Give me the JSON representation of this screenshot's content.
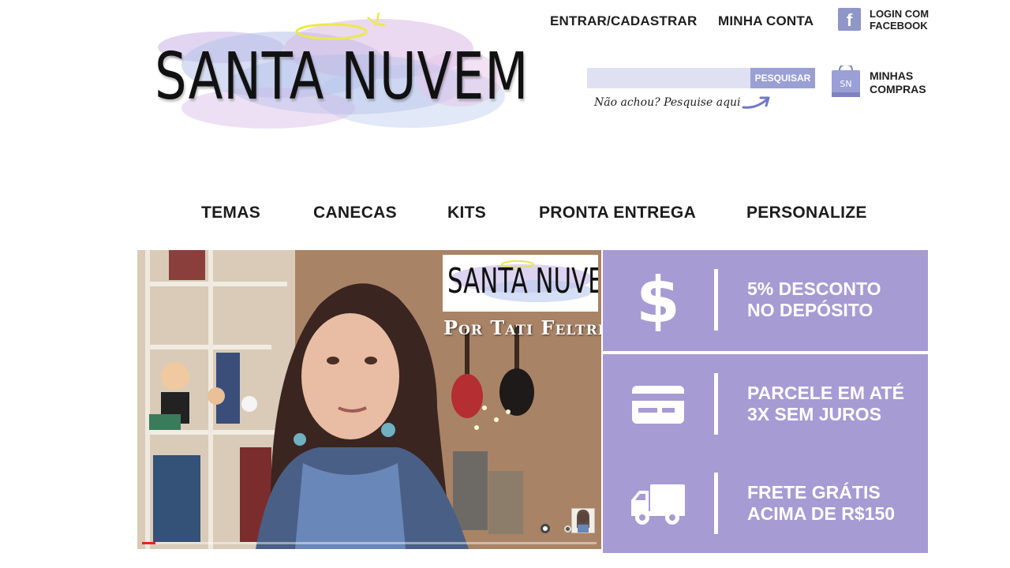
{
  "header": {
    "logo_text": "SANTA NUVEM",
    "links": {
      "login_register": "ENTRAR/CADASTRAR",
      "my_account": "MINHA CONTA",
      "facebook_login_line1": "LOGIN COM",
      "facebook_login_line2": "FACEBOOK"
    },
    "facebook_icon": "f",
    "search": {
      "value": "",
      "placeholder": "",
      "button_label": "PESQUISAR",
      "hint": "Não achou? Pesquise aqui"
    },
    "cart": {
      "icon_text": "SN",
      "label_line1": "MINHAS",
      "label_line2": "COMPRAS"
    }
  },
  "nav": {
    "items": [
      {
        "label": "TEMAS"
      },
      {
        "label": "CANECAS"
      },
      {
        "label": "KITS"
      },
      {
        "label": "PRONTA ENTREGA"
      },
      {
        "label": "PERSONALIZE"
      }
    ]
  },
  "video": {
    "overlay_logo": "SANTA NUVEM",
    "byline": "Por Tati Feltrin",
    "progress": 0.03,
    "slides": 2,
    "active_slide": 1
  },
  "promos": [
    {
      "icon": "dollar-icon",
      "glyph": "$",
      "line1": "5% DESCONTO",
      "line2": "NO DEPÓSITO"
    },
    {
      "icon": "credit-card-icon",
      "line1": "PARCELE EM ATÉ",
      "line2": "3X SEM JUROS"
    },
    {
      "icon": "truck-icon",
      "line1": "FRETE GRÁTIS",
      "line2": "ACIMA DE R$150"
    }
  ],
  "colors": {
    "accent_lavender": "#a79bd4",
    "search_button": "#9a9fd6",
    "search_field": "#dfe1f3",
    "facebook_box": "#8f97c9"
  }
}
